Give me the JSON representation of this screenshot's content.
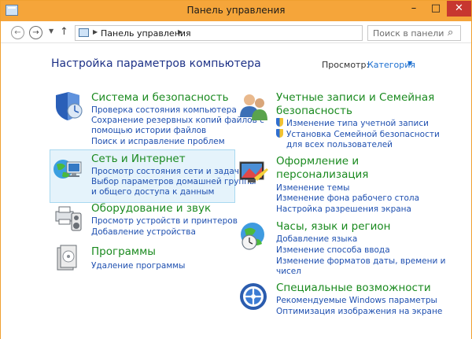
{
  "window": {
    "title": "Панель управления"
  },
  "navbar": {
    "address_text": "Панель управления",
    "search_placeholder": "Поиск в панели у..."
  },
  "content": {
    "heading": "Настройка параметров компьютера",
    "view_label": "Просмотр:",
    "view_value": "Категория"
  },
  "categories_left": [
    {
      "title": "Система и безопасность",
      "links": [
        "Проверка состояния компьютера",
        "Сохранение резервных копий файлов с",
        "помощью истории файлов",
        "Поиск и исправление проблем"
      ]
    },
    {
      "title": "Сеть и Интернет",
      "links": [
        "Просмотр состояния сети и задач",
        "Выбор параметров домашней группы",
        "и общего доступа к данным"
      ]
    },
    {
      "title": "Оборудование и звук",
      "links": [
        "Просмотр устройств и принтеров",
        "Добавление устройства"
      ]
    },
    {
      "title": "Программы",
      "links": [
        "Удаление программы"
      ]
    }
  ],
  "categories_right": [
    {
      "title_line1": "Учетные записи и Семейная",
      "title_line2": "безопасность",
      "links": [
        "Изменение типа учетной записи",
        "Установка Семейной безопасности",
        "для всех пользователей"
      ]
    },
    {
      "title_line1": "Оформление и",
      "title_line2": "персонализация",
      "links": [
        "Изменение темы",
        "Изменение фона рабочего стола",
        "Настройка разрешения экрана"
      ]
    },
    {
      "title": "Часы, язык и регион",
      "links": [
        "Добавление языка",
        "Изменение способа ввода",
        "Изменение форматов даты, времени и",
        "чисел"
      ]
    },
    {
      "title": "Специальные возможности",
      "links": [
        "Рекомендуемые Windows параметры",
        "Оптимизация изображения на экране"
      ]
    }
  ]
}
